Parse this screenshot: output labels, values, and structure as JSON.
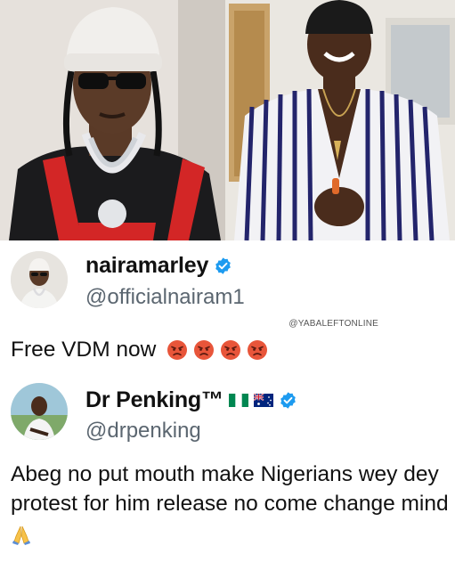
{
  "photos": {
    "left_alt": "naira marley photo",
    "right_alt": "vdm photo"
  },
  "tweets": [
    {
      "display_name": "nairamarley",
      "handle": "@officialnairam1",
      "watermark": "@YABALEFTONLINE",
      "text": "Free VDM now",
      "emoji": [
        "angry-face-icon",
        "angry-face-icon",
        "angry-face-icon",
        "angry-face-icon"
      ],
      "verified_color": "#1d9bf0"
    },
    {
      "display_name": "Dr Penking™",
      "handle": "@drpenking",
      "text": "Abeg no put mouth make Nigerians wey dey protest for him release no come change mind",
      "flags": [
        "nigeria-flag-icon",
        "australia-flag-icon"
      ],
      "emoji": [
        "folded-hands-icon"
      ],
      "verified_color": "#1d9bf0"
    }
  ],
  "colors": {
    "text": "#111111",
    "handle": "#5b6670",
    "verified": "#1d9bf0",
    "angry_emoji": "#e8553a"
  }
}
